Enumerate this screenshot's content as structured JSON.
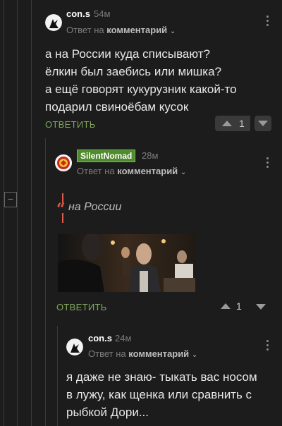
{
  "comments": [
    {
      "username": "con.s",
      "time": "54м",
      "reply_prefix": "Ответ на",
      "reply_target": "комментарий",
      "lines": [
        "а на России куда списывают?",
        "ёлкин был заебись или мишка?",
        "а ещё говорят кукурузник какой-то",
        "подарил свиноёбам кусок"
      ],
      "reply_label": "ОТВЕТИТЬ",
      "votes": "1"
    },
    {
      "username": "SilentNomad",
      "time": "28м",
      "reply_prefix": "Ответ на",
      "reply_target": "комментарий",
      "quote": "на России",
      "reply_label": "ОТВЕТИТЬ",
      "votes": "1"
    },
    {
      "username": "con.s",
      "time": "24м",
      "reply_prefix": "Ответ на",
      "reply_target": "комментарий",
      "lines": [
        "я даже не знаю- тыкать вас носом",
        "в лужу, как щенка или сравнить с",
        "рыбкой Дори..."
      ]
    }
  ],
  "collapse_symbol": "−",
  "colors": {
    "accent": "#7fa85a",
    "badge": "#4f8a2e",
    "quote": "#e05a4a",
    "background": "#1c1c1c"
  }
}
